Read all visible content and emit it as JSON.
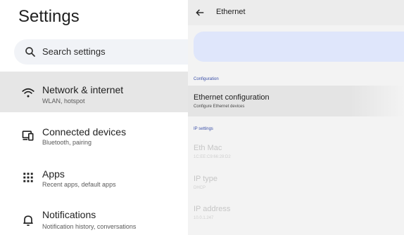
{
  "settings": {
    "title": "Settings",
    "search": {
      "placeholder": "Search settings",
      "icon": "search-icon"
    },
    "items": [
      {
        "title": "Network & internet",
        "subtitle": "WLAN, hotspot",
        "icon": "wifi-icon",
        "active": true
      },
      {
        "title": "Connected devices",
        "subtitle": "Bluetooth, pairing",
        "icon": "devices-icon",
        "active": false
      },
      {
        "title": "Apps",
        "subtitle": "Recent apps, default apps",
        "icon": "apps-grid-icon",
        "active": false
      },
      {
        "title": "Notifications",
        "subtitle": "Notification history, conversations",
        "icon": "bell-icon",
        "active": false
      }
    ]
  },
  "ethernet": {
    "header_title": "Ethernet",
    "back_icon": "back-arrow-icon",
    "sections": {
      "configuration": "Configuration",
      "ip_settings": "IP settings"
    },
    "config_row": {
      "title": "Ethernet configuration",
      "subtitle": "Configure Ethernet devices"
    },
    "fields": [
      {
        "title": "Eth Mac",
        "value": "1C:EE:C9:66:28:D2"
      },
      {
        "title": "IP type",
        "value": "DHCP"
      },
      {
        "title": "IP address",
        "value": "10.0.1.247"
      }
    ]
  },
  "colors": {
    "accent": "#3a4fa8",
    "banner": "#dfe6fb",
    "selected": "#e6e6e6"
  }
}
